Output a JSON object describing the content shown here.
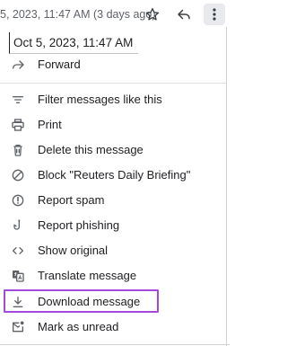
{
  "header": {
    "timestamp": "5, 2023, 11:47 AM (3 days ago)"
  },
  "menu": {
    "date": "Oct 5, 2023, 11:47 AM",
    "items": [
      {
        "label": "Forward",
        "icon": "forward-icon"
      },
      {
        "label": "Filter messages like this",
        "icon": "filter-icon"
      },
      {
        "label": "Print",
        "icon": "print-icon"
      },
      {
        "label": "Delete this message",
        "icon": "trash-icon"
      },
      {
        "label": "Block \"Reuters Daily Briefing\"",
        "icon": "block-icon"
      },
      {
        "label": "Report spam",
        "icon": "spam-icon"
      },
      {
        "label": "Report phishing",
        "icon": "phishing-icon"
      },
      {
        "label": "Show original",
        "icon": "code-icon"
      },
      {
        "label": "Translate message",
        "icon": "translate-icon"
      },
      {
        "label": "Download message",
        "icon": "download-icon"
      },
      {
        "label": "Mark as unread",
        "icon": "mark-unread-icon"
      }
    ]
  },
  "colors": {
    "highlight": "#a24bdb",
    "icon": "#5f6368",
    "text": "#202124"
  }
}
